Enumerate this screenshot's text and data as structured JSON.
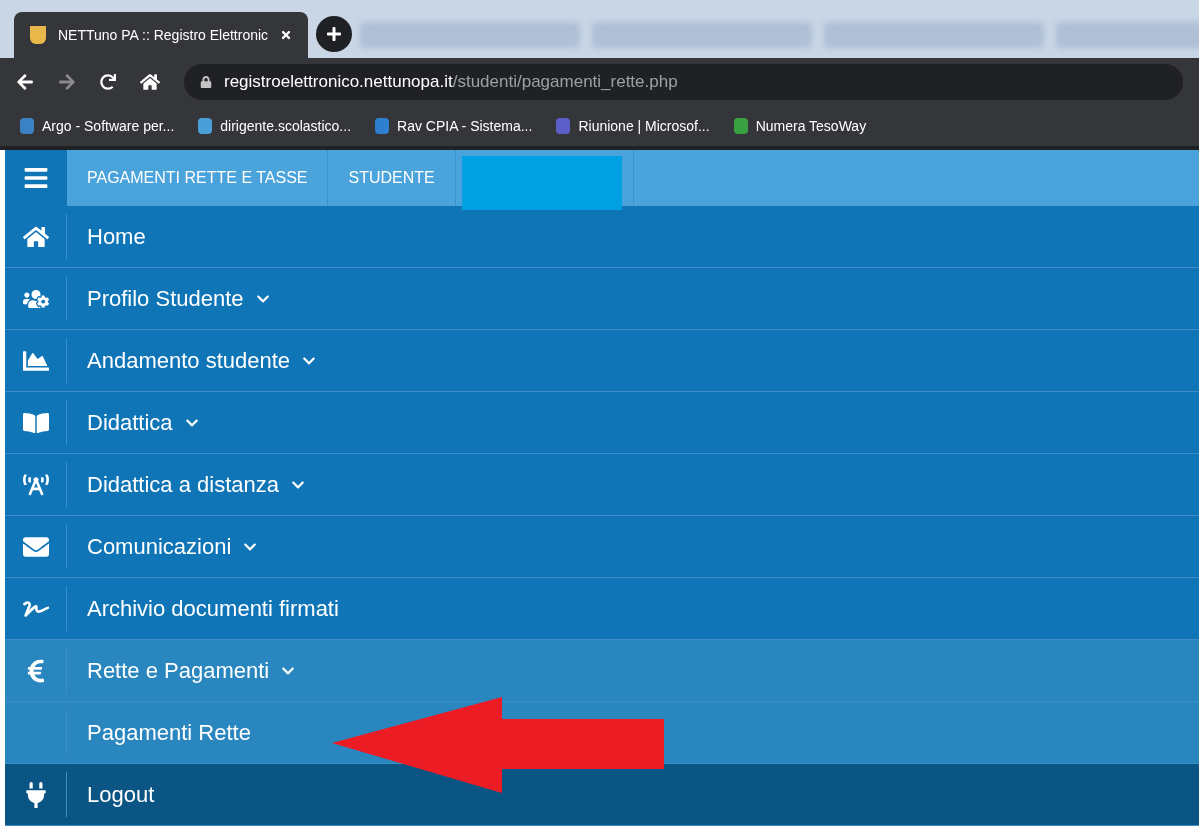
{
  "browser": {
    "tab": {
      "title": "NETTuno PA :: Registro Elettronic"
    },
    "url": {
      "domain": "registroelettronico.nettunopa.it",
      "path": "/studenti/pagamenti_rette.php"
    },
    "bookmarks": [
      "Argo - Software per...",
      "dirigente.scolastico...",
      "Rav CPIA - Sistema...",
      "Riunione | Microsof...",
      "Numera TesoWay"
    ]
  },
  "header": {
    "breadcrumbs": [
      "PAGAMENTI RETTE E TASSE",
      "STUDENTE"
    ]
  },
  "menu": [
    {
      "kind": "item",
      "label": "Home"
    },
    {
      "kind": "group",
      "label": "Profilo Studente",
      "expanded": false
    },
    {
      "kind": "group",
      "label": "Andamento studente",
      "expanded": false
    },
    {
      "kind": "group",
      "label": "Didattica",
      "expanded": false
    },
    {
      "kind": "group",
      "label": "Didattica a distanza",
      "expanded": false
    },
    {
      "kind": "group",
      "label": "Comunicazioni",
      "expanded": false
    },
    {
      "kind": "item",
      "label": "Archivio documenti firmati"
    },
    {
      "kind": "group",
      "label": "Rette e Pagamenti",
      "expanded": true,
      "children": [
        {
          "label": "Pagamenti Rette",
          "selected": true
        }
      ]
    },
    {
      "kind": "logout",
      "label": "Logout"
    }
  ]
}
